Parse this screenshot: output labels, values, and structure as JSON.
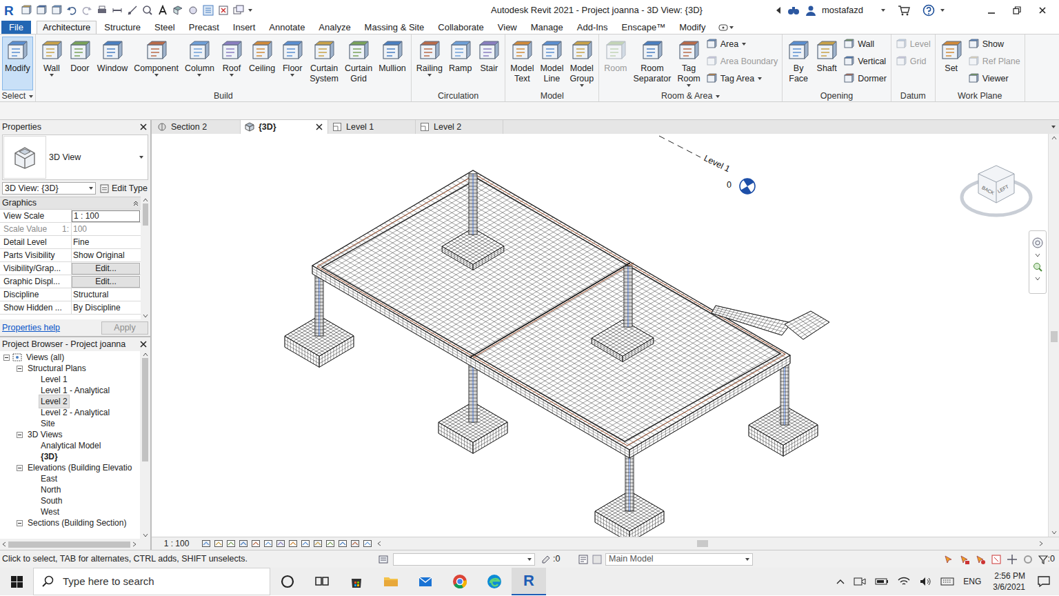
{
  "app": {
    "logo": "R",
    "title": "Autodesk Revit 2021 - Project joanna - 3D View: {3D}",
    "user": "mostafazd"
  },
  "ribbon_tabs": [
    {
      "label": "File",
      "selected": false,
      "kind": "file"
    },
    {
      "label": "Architecture",
      "selected": true,
      "kind": "tab"
    },
    {
      "label": "Structure",
      "selected": false,
      "kind": "tab"
    },
    {
      "label": "Steel",
      "selected": false,
      "kind": "tab"
    },
    {
      "label": "Precast",
      "selected": false,
      "kind": "tab"
    },
    {
      "label": "Insert",
      "selected": false,
      "kind": "tab"
    },
    {
      "label": "Annotate",
      "selected": false,
      "kind": "tab"
    },
    {
      "label": "Analyze",
      "selected": false,
      "kind": "tab"
    },
    {
      "label": "Massing & Site",
      "selected": false,
      "kind": "tab"
    },
    {
      "label": "Collaborate",
      "selected": false,
      "kind": "tab"
    },
    {
      "label": "View",
      "selected": false,
      "kind": "tab"
    },
    {
      "label": "Manage",
      "selected": false,
      "kind": "tab"
    },
    {
      "label": "Add-Ins",
      "selected": false,
      "kind": "tab"
    },
    {
      "label": "Enscape™",
      "selected": false,
      "kind": "tab"
    },
    {
      "label": "Modify",
      "selected": false,
      "kind": "tab"
    }
  ],
  "ribbon_groups": [
    {
      "label": "Select",
      "menu": true,
      "buttons": [
        {
          "label": "Modify",
          "kind": "large",
          "selected": true,
          "disabled": false,
          "menu": false
        }
      ]
    },
    {
      "label": "Build",
      "menu": false,
      "buttons": [
        {
          "label": "Wall",
          "kind": "large",
          "selected": false,
          "disabled": false,
          "menu": true
        },
        {
          "label": "Door",
          "kind": "large",
          "selected": false,
          "disabled": false,
          "menu": false
        },
        {
          "label": "Window",
          "kind": "large",
          "selected": false,
          "disabled": false,
          "menu": false
        },
        {
          "label": "Component",
          "kind": "large",
          "selected": false,
          "disabled": false,
          "menu": true
        },
        {
          "label": "Column",
          "kind": "large",
          "selected": false,
          "disabled": false,
          "menu": true
        },
        {
          "label": "Roof",
          "kind": "large",
          "selected": false,
          "disabled": false,
          "menu": true
        },
        {
          "label": "Ceiling",
          "kind": "large",
          "selected": false,
          "disabled": false,
          "menu": false
        },
        {
          "label": "Floor",
          "kind": "large",
          "selected": false,
          "disabled": false,
          "menu": true
        },
        {
          "label": "Curtain System",
          "kind": "large",
          "selected": false,
          "disabled": false,
          "menu": false
        },
        {
          "label": "Curtain Grid",
          "kind": "large",
          "selected": false,
          "disabled": false,
          "menu": false
        },
        {
          "label": "Mullion",
          "kind": "large",
          "selected": false,
          "disabled": false,
          "menu": false
        }
      ]
    },
    {
      "label": "Circulation",
      "menu": false,
      "buttons": [
        {
          "label": "Railing",
          "kind": "large",
          "selected": false,
          "disabled": false,
          "menu": true
        },
        {
          "label": "Ramp",
          "kind": "large",
          "selected": false,
          "disabled": false,
          "menu": false
        },
        {
          "label": "Stair",
          "kind": "large",
          "selected": false,
          "disabled": false,
          "menu": false
        }
      ]
    },
    {
      "label": "Model",
      "menu": false,
      "buttons": [
        {
          "label": "Model Text",
          "kind": "large",
          "selected": false,
          "disabled": false,
          "menu": false
        },
        {
          "label": "Model Line",
          "kind": "large",
          "selected": false,
          "disabled": false,
          "menu": false
        },
        {
          "label": "Model Group",
          "kind": "large",
          "selected": false,
          "disabled": false,
          "menu": true
        }
      ]
    },
    {
      "label": "Room & Area",
      "menu": true,
      "buttons": [
        {
          "label": "Room",
          "kind": "large",
          "selected": false,
          "disabled": true,
          "menu": false
        },
        {
          "label": "Room Separator",
          "kind": "large",
          "selected": false,
          "disabled": false,
          "menu": false
        },
        {
          "label": "Tag Room",
          "kind": "large",
          "selected": false,
          "disabled": false,
          "menu": true
        },
        {
          "label": "Area",
          "kind": "small",
          "selected": false,
          "disabled": false,
          "menu": true
        },
        {
          "label": "Area Boundary",
          "kind": "small",
          "selected": false,
          "disabled": true,
          "menu": false
        },
        {
          "label": "Tag Area",
          "kind": "small",
          "selected": false,
          "disabled": false,
          "menu": true
        }
      ]
    },
    {
      "label": "Opening",
      "menu": false,
      "buttons": [
        {
          "label": "By Face",
          "kind": "large",
          "selected": false,
          "disabled": false,
          "menu": false
        },
        {
          "label": "Shaft",
          "kind": "large",
          "selected": false,
          "disabled": false,
          "menu": false
        },
        {
          "label": "Wall",
          "kind": "small",
          "selected": false,
          "disabled": false,
          "menu": false
        },
        {
          "label": "Vertical",
          "kind": "small",
          "selected": false,
          "disabled": false,
          "menu": false
        },
        {
          "label": "Dormer",
          "kind": "small",
          "selected": false,
          "disabled": false,
          "menu": false
        }
      ]
    },
    {
      "label": "Datum",
      "menu": false,
      "buttons": [
        {
          "label": "Level",
          "kind": "small",
          "selected": false,
          "disabled": true,
          "menu": false
        },
        {
          "label": "Grid",
          "kind": "small",
          "selected": false,
          "disabled": true,
          "menu": false
        }
      ]
    },
    {
      "label": "Work Plane",
      "menu": false,
      "buttons": [
        {
          "label": "Set",
          "kind": "large",
          "selected": false,
          "disabled": false,
          "menu": false
        },
        {
          "label": "Show",
          "kind": "small",
          "selected": false,
          "disabled": false,
          "menu": false
        },
        {
          "label": "Ref Plane",
          "kind": "small",
          "selected": false,
          "disabled": true,
          "menu": false
        },
        {
          "label": "Viewer",
          "kind": "small",
          "selected": false,
          "disabled": false,
          "menu": false
        }
      ]
    }
  ],
  "view_tabs": [
    {
      "label": "Section 2",
      "selected": false,
      "kind": "section"
    },
    {
      "label": "{3D}",
      "selected": true,
      "kind": "3d"
    },
    {
      "label": "Level 1",
      "selected": false,
      "kind": "plan"
    },
    {
      "label": "Level 2",
      "selected": false,
      "kind": "plan"
    }
  ],
  "properties": {
    "title": "Properties",
    "type_name": "3D View",
    "selector": "3D View: {3D}",
    "edit_type": "Edit Type",
    "section": "Graphics",
    "rows": [
      {
        "label": "View Scale",
        "prefix": "",
        "value": "1 : 100",
        "kind": "input"
      },
      {
        "label": "Scale Value",
        "prefix": "1:",
        "value": "100",
        "kind": "disabled"
      },
      {
        "label": "Detail Level",
        "prefix": "",
        "value": "Fine",
        "kind": "text"
      },
      {
        "label": "Parts Visibility",
        "prefix": "",
        "value": "Show Original",
        "kind": "text"
      },
      {
        "label": "Visibility/Grap...",
        "prefix": "",
        "value": "Edit...",
        "kind": "button"
      },
      {
        "label": "Graphic Displ...",
        "prefix": "",
        "value": "Edit...",
        "kind": "button"
      },
      {
        "label": "Discipline",
        "prefix": "",
        "value": "Structural",
        "kind": "text"
      },
      {
        "label": "Show Hidden ...",
        "prefix": "",
        "value": "By Discipline",
        "kind": "text"
      }
    ],
    "help": "Properties help",
    "apply": "Apply",
    "apply_disabled": true
  },
  "project_browser": {
    "title": "Project Browser - Project joanna",
    "items": [
      {
        "label": "Views (all)",
        "expanded": true,
        "selected": false,
        "current": false,
        "children": [
          {
            "label": "Structural Plans",
            "expanded": true,
            "selected": false,
            "current": false,
            "children": [
              {
                "label": "Level 1",
                "selected": false,
                "current": false
              },
              {
                "label": "Level 1 - Analytical",
                "selected": false,
                "current": false
              },
              {
                "label": "Level 2",
                "selected": true,
                "current": false
              },
              {
                "label": "Level 2 - Analytical",
                "selected": false,
                "current": false
              },
              {
                "label": "Site",
                "selected": false,
                "current": false
              }
            ]
          },
          {
            "label": "3D Views",
            "expanded": true,
            "selected": false,
            "current": false,
            "children": [
              {
                "label": "Analytical Model",
                "selected": false,
                "current": false
              },
              {
                "label": "{3D}",
                "selected": false,
                "current": true
              }
            ]
          },
          {
            "label": "Elevations (Building Elevatio",
            "expanded": true,
            "selected": false,
            "current": false,
            "children": [
              {
                "label": "East",
                "selected": false,
                "current": false
              },
              {
                "label": "North",
                "selected": false,
                "current": false
              },
              {
                "label": "South",
                "selected": false,
                "current": false
              },
              {
                "label": "West",
                "selected": false,
                "current": false
              }
            ]
          },
          {
            "label": "Sections (Building Section)",
            "expanded": true,
            "selected": false,
            "current": false,
            "children": []
          }
        ]
      }
    ]
  },
  "canvas": {
    "level_name": "Level 1",
    "level_value": "0",
    "viewcube": [
      "BACK",
      "LEFT"
    ]
  },
  "view_control": {
    "scale": "1 : 100"
  },
  "status_bar": {
    "message": "Click to select, TAB for alternates, CTRL adds, SHIFT unselects.",
    "selection_count": ":0",
    "workset": "Main Model",
    "filter_count": ":0"
  },
  "taskbar": {
    "search_placeholder": "Type here to search",
    "revit_label": "R",
    "language": "ENG",
    "time": "2:56 PM",
    "date": "3/6/2021"
  }
}
